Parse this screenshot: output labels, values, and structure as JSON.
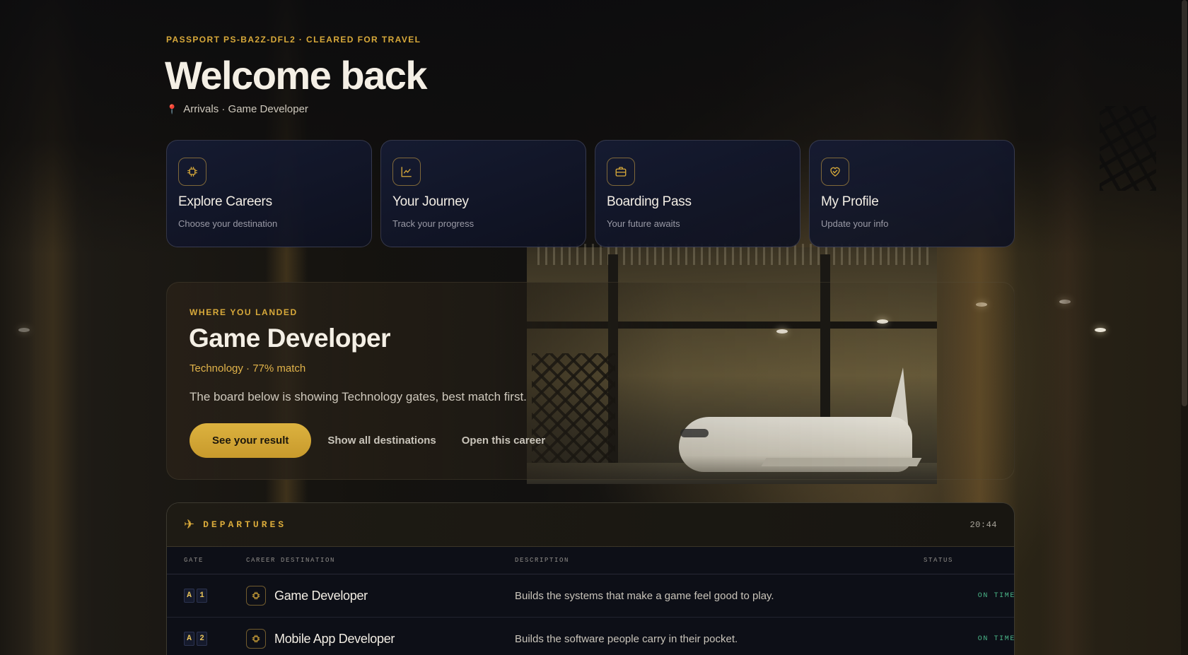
{
  "header": {
    "eyebrow": "PASSPORT PS-BA2Z-DFL2 · CLEARED FOR TRAVEL",
    "title": "Welcome back",
    "location": "Arrivals · Game Developer"
  },
  "cards": [
    {
      "title": "Explore Careers",
      "subtitle": "Choose your destination",
      "icon": "chip-icon"
    },
    {
      "title": "Your Journey",
      "subtitle": "Track your progress",
      "icon": "chart-line-icon"
    },
    {
      "title": "Boarding Pass",
      "subtitle": "Your future awaits",
      "icon": "briefcase-icon"
    },
    {
      "title": "My Profile",
      "subtitle": "Update your info",
      "icon": "heart-handshake-icon"
    }
  ],
  "landed": {
    "eyebrow": "WHERE YOU LANDED",
    "title": "Game Developer",
    "meta": "Technology · 77% match",
    "description": "The board below is showing Technology gates, best match first.",
    "primary_button": "See your result",
    "link_all": "Show all destinations",
    "link_career": "Open this career"
  },
  "board": {
    "title": "DEPARTURES",
    "clock": "20:44",
    "columns": {
      "gate": "GATE",
      "destination": "CAREER DESTINATION",
      "description": "DESCRIPTION",
      "status": "STATUS"
    },
    "rows": [
      {
        "gate": [
          "A",
          "1"
        ],
        "name": "Game Developer",
        "description": "Builds the systems that make a game feel good to play.",
        "status": "ON TIME"
      },
      {
        "gate": [
          "A",
          "2"
        ],
        "name": "Mobile App Developer",
        "description": "Builds the software people carry in their pocket.",
        "status": "ON TIME"
      }
    ]
  },
  "colors": {
    "accent": "#d8a93a",
    "status_ok": "#4bb88a",
    "card_bg": "#161c34"
  }
}
